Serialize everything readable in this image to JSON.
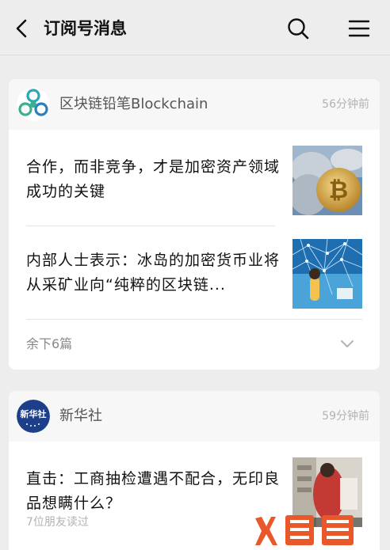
{
  "header": {
    "title": "订阅号消息",
    "back_icon": "back-arrow-icon",
    "search_icon": "search-icon",
    "menu_icon": "menu-icon"
  },
  "feeds": [
    {
      "account": "区块链铅笔Blockchain",
      "time": "56分钟前",
      "avatar_icon": "blockchain-logo-icon",
      "articles": [
        {
          "title": "合作，而非竞争，才是加密资产领域成功的关键",
          "thumb": "bitcoin-coins-image"
        },
        {
          "title": "内部人士表示：冰岛的加密货币业将从采矿业向“纯粹的区块链...",
          "thumb": "blockchain-network-image"
        }
      ],
      "more": "余下6篇"
    },
    {
      "account": "新华社",
      "time": "59分钟前",
      "avatar_icon": "xinhua-logo-icon",
      "avatar_text": "新华社",
      "articles": [
        {
          "title": "直击：工商抽检遭遇不配合，无印良品想瞒什么？",
          "thumb": "store-inspection-image"
        }
      ],
      "friends_read": "7位朋友读过"
    }
  ],
  "watermark": {
    "text": "火鲤鱼"
  },
  "colors": {
    "background": "#ededed",
    "card": "#ffffff",
    "muted": "#b2b2b2",
    "accent": "#e8582b"
  }
}
